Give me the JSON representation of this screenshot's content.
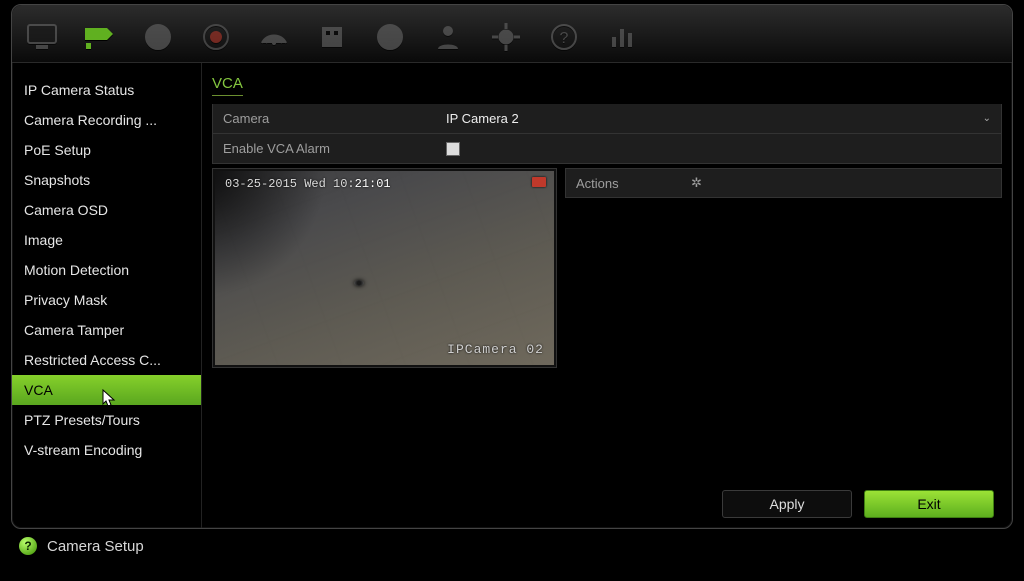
{
  "accent_color": "#6db33f",
  "toolbar": {
    "items": [
      {
        "name": "monitor-icon",
        "active": false
      },
      {
        "name": "camera-icon",
        "active": true
      },
      {
        "name": "globe-dots-icon",
        "active": false
      },
      {
        "name": "record-icon",
        "active": false
      },
      {
        "name": "radar-icon",
        "active": false
      },
      {
        "name": "building-icon",
        "active": false
      },
      {
        "name": "disc-icon",
        "active": false
      },
      {
        "name": "person-icon",
        "active": false
      },
      {
        "name": "gear-large-icon",
        "active": false
      },
      {
        "name": "help-icon",
        "active": false
      },
      {
        "name": "chart-icon",
        "active": false
      }
    ]
  },
  "sidebar": {
    "items": [
      {
        "label": "IP Camera Status"
      },
      {
        "label": "Camera Recording ..."
      },
      {
        "label": "PoE Setup"
      },
      {
        "label": "Snapshots"
      },
      {
        "label": "Camera OSD"
      },
      {
        "label": "Image"
      },
      {
        "label": "Motion Detection"
      },
      {
        "label": "Privacy Mask"
      },
      {
        "label": "Camera Tamper"
      },
      {
        "label": "Restricted Access C..."
      },
      {
        "label": "VCA"
      },
      {
        "label": "PTZ Presets/Tours"
      },
      {
        "label": "V-stream Encoding"
      }
    ],
    "selected_index": 10
  },
  "page_title": "VCA",
  "form": {
    "camera": {
      "label": "Camera",
      "value": "IP Camera 2"
    },
    "enable": {
      "label": "Enable VCA Alarm",
      "checked": false
    }
  },
  "preview": {
    "timestamp_prefix": "03-25-2015 Wed 10:",
    "timestamp_highlight": "21:01",
    "camera_label": "IPCamera 02"
  },
  "actions": {
    "label": "Actions",
    "icon": "gear-icon"
  },
  "buttons": {
    "apply": "Apply",
    "exit": "Exit"
  },
  "statusbar": {
    "help_glyph": "?",
    "text": "Camera Setup"
  }
}
